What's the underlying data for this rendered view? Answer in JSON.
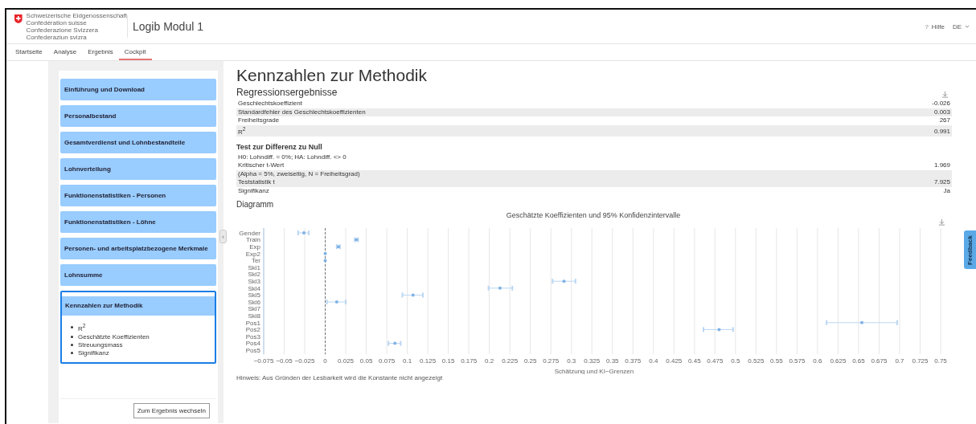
{
  "header": {
    "coat_of_arms_lines": [
      "Schweizerische Eidgenossenschaft",
      "Confédération suisse",
      "Confederazione Svizzera",
      "Confederaziun svizra"
    ],
    "app_title": "Logib Modul 1",
    "help": {
      "icon": "?",
      "label": "Hilfe"
    },
    "language": "DE"
  },
  "tabs": [
    {
      "label": "Startseite",
      "selected": false
    },
    {
      "label": "Analyse",
      "selected": false
    },
    {
      "label": "Ergebnis",
      "selected": false
    },
    {
      "label": "Cockpit",
      "selected": true
    }
  ],
  "sidebar": {
    "items": [
      {
        "label": "Einführung und Download",
        "expanded": false
      },
      {
        "label": "Personalbestand",
        "expanded": false
      },
      {
        "label": "Gesamtverdienst und Lohnbestandteile",
        "expanded": false
      },
      {
        "label": "Lohnverteilung",
        "expanded": false
      },
      {
        "label": "Funktionenstatistiken - Personen",
        "expanded": false
      },
      {
        "label": "Funktionenstatistiken - Löhne",
        "expanded": false
      },
      {
        "label": "Personen- und arbeitsplatzbezogene Merkmale",
        "expanded": false
      },
      {
        "label": "Lohnsumme",
        "expanded": false
      },
      {
        "label": "Kennzahlen zur Methodik",
        "expanded": true,
        "children": [
          "R$^{2}$",
          "Geschätzte Koeffizienten",
          "Streuungsmass",
          "Signifikanz"
        ]
      }
    ],
    "collapse_handle": "‹",
    "button": "Zum Ergebnis wechseln"
  },
  "main": {
    "title": "Kennzahlen zur Methodik",
    "regression": {
      "heading": "Regressionsergebnisse",
      "rows": [
        {
          "lines": [
            "Geschlechtskoeffizient"
          ],
          "value": "-0.026"
        },
        {
          "lines": [
            "Standardfehler des Geschlechtskoeffizienten"
          ],
          "value": "0.003"
        },
        {
          "lines": [
            "Freiheitsgrade"
          ],
          "value": "267"
        },
        {
          "lines": [
            "R$^{2}$"
          ],
          "value": "0.991"
        }
      ]
    },
    "test": {
      "heading": "Test zur Differenz zu Null",
      "rows": [
        {
          "lines": [
            "H0: Lohndiff. = 0%; HA: Lohndiff. <> 0",
            "Kritischer t-Wert"
          ],
          "value": "1.969"
        },
        {
          "lines": [
            "(Alpha = 5%, zweiseitig, N = Freiheitsgrad)",
            "Teststatistik t"
          ],
          "value": "7.925"
        },
        {
          "lines": [
            "Signifikanz"
          ],
          "value": "Ja"
        }
      ]
    },
    "diagram": {
      "heading": "Diagramm",
      "note": "Hinweis: Aus Gründen der Lesbarkeit wird die Konstante nicht angezeigt",
      "chart_data": {
        "type": "scatter",
        "orientation": "horizontal",
        "title": "Geschätzte Koeffizienten und 95% Konfidenzintervalle",
        "xlabel": "Schätzung und KI−Grenzen",
        "categories": [
          "Gender",
          "Train",
          "Exp",
          "Exp2",
          "Ter",
          "Skl1",
          "Skl2",
          "Skl3",
          "Skl4",
          "Skl5",
          "Skl6",
          "Skl7",
          "Skl8",
          "Pos1",
          "Pos2",
          "Pos3",
          "Pos4",
          "Pos5"
        ],
        "xlim": [
          -0.075,
          0.75
        ],
        "xticks": [
          {
            "value": -0.075,
            "label": "−0.075"
          },
          {
            "value": -0.05,
            "label": "−0.05"
          },
          {
            "value": -0.025,
            "label": "−0.025"
          },
          0,
          0.025,
          0.05,
          0.075,
          0.1,
          0.125,
          0.15,
          0.175,
          0.2,
          0.225,
          0.25,
          0.275,
          0.3,
          0.325,
          0.35,
          0.375,
          0.4,
          0.425,
          0.45,
          0.475,
          0.5,
          0.525,
          0.55,
          0.575,
          0.6,
          0.625,
          0.65,
          0.675,
          0.7,
          0.725,
          0.75
        ],
        "grid": true,
        "ref_lines": [
          {
            "axis": "x",
            "value": 0
          }
        ],
        "series": [
          {
            "color": "#7fb2e5",
            "values": [
              -0.026,
              0.038,
              0.016,
              0,
              0,
              null,
              null,
              0.291,
              0.213,
              0.107,
              0.014,
              null,
              null,
              0.654,
              0.48,
              null,
              0.085,
              null
            ]
          },
          {
            "color": "#b9d6f2",
            "values": [
              -0.033,
              0.036,
              0.014,
              null,
              null,
              null,
              null,
              0.277,
              0.199,
              0.094,
              0.002,
              null,
              null,
              0.611,
              0.461,
              null,
              0.077,
              null
            ]
          },
          {
            "color": "#b9d6f2",
            "values": [
              -0.02,
              0.04,
              0.018,
              null,
              null,
              null,
              null,
              0.305,
              0.228,
              0.119,
              0.025,
              null,
              null,
              0.697,
              0.497,
              null,
              0.092,
              null
            ]
          }
        ]
      }
    }
  },
  "feedback_tab": "Feedback"
}
